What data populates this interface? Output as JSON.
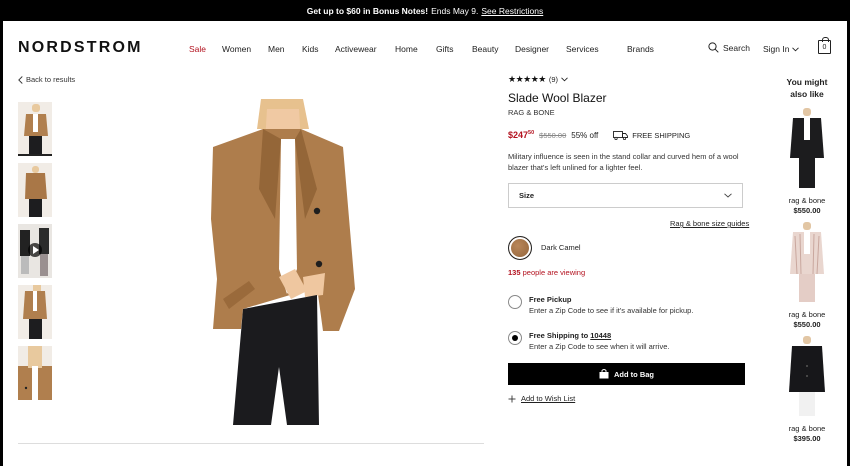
{
  "promo": {
    "bold": "Get up to $60 in Bonus Notes!",
    "text": "Ends May 9.",
    "link": "See Restrictions"
  },
  "header": {
    "logo": "NORDSTROM",
    "nav": [
      "Sale",
      "Women",
      "Men",
      "Kids",
      "Activewear",
      "Home",
      "Gifts",
      "Beauty",
      "Designer",
      "Services",
      "Brands"
    ],
    "search_label": "Search",
    "signin_label": "Sign In",
    "bag_count": "0"
  },
  "breadcrumb": {
    "back": "Back to results"
  },
  "product": {
    "stars": "★★★★★",
    "review_count": "(9)",
    "title": "Slade Wool Blazer",
    "brand": "RAG & BONE",
    "price_dollars": "$247",
    "price_cents": "50",
    "original_price": "$550.00",
    "discount": "55% off",
    "shipping": "FREE SHIPPING",
    "description": "Military influence is seen in the stand collar and curved hem of a wool blazer that's left unlined for a lighter feel.",
    "size_label": "Size",
    "size_guide": "Rag & bone size guides",
    "color_name": "Dark Camel",
    "viewing_count": "135",
    "viewing_text": "people are viewing",
    "pickup_title": "Free Pickup",
    "pickup_sub": "Enter a Zip Code to see if it's available for pickup.",
    "shipping_title": "Free Shipping to",
    "shipping_zip": "10448",
    "shipping_sub": "Enter a Zip Code to see when it will arrive.",
    "add_to_bag": "Add to Bag",
    "wish_list": "Add to Wish List"
  },
  "recommendations": {
    "title_line1": "You might",
    "title_line2": "also like",
    "items": [
      {
        "brand": "rag & bone",
        "price": "$550.00"
      },
      {
        "brand": "rag & bone",
        "price": "$550.00"
      },
      {
        "brand": "rag & bone",
        "price": "$395.00"
      }
    ]
  },
  "colors": {
    "sale_red": "#b3121f",
    "camel": "#a77547",
    "black": "#000000"
  }
}
